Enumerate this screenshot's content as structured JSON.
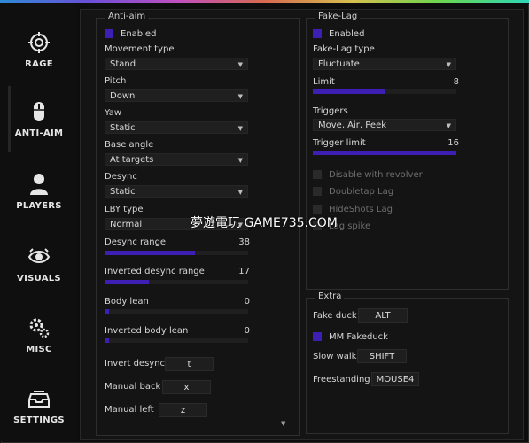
{
  "sidebar": {
    "tabs": [
      {
        "label": "RAGE",
        "icon": "crosshair-icon"
      },
      {
        "label": "ANTI-AIM",
        "icon": "mouse-icon"
      },
      {
        "label": "PLAYERS",
        "icon": "person-icon"
      },
      {
        "label": "VISUALS",
        "icon": "eye-icon"
      },
      {
        "label": "MISC",
        "icon": "gears-icon"
      },
      {
        "label": "SETTINGS",
        "icon": "tray-icon"
      }
    ]
  },
  "antiaim": {
    "title": "Anti-aim",
    "enabled_label": "Enabled",
    "movement_type_label": "Movement type",
    "movement_type_value": "Stand",
    "pitch_label": "Pitch",
    "pitch_value": "Down",
    "yaw_label": "Yaw",
    "yaw_value": "Static",
    "base_angle_label": "Base angle",
    "base_angle_value": "At targets",
    "desync_label": "Desync",
    "desync_value": "Static",
    "lby_type_label": "LBY type",
    "lby_type_value": "Normal",
    "desync_range_label": "Desync range",
    "desync_range_value": "38",
    "desync_range_fraction": 0.63,
    "inv_desync_range_label": "Inverted desync range",
    "inv_desync_range_value": "17",
    "inv_desync_range_fraction": 0.31,
    "body_lean_label": "Body lean",
    "body_lean_value": "0",
    "body_lean_fraction": 0.03,
    "inv_body_lean_label": "Inverted body lean",
    "inv_body_lean_value": "0",
    "inv_body_lean_fraction": 0.03,
    "invert_desync_label": "Invert desync",
    "invert_desync_key": "t",
    "manual_back_label": "Manual back",
    "manual_back_key": "x",
    "manual_left_label": "Manual left",
    "manual_left_key": "z"
  },
  "fakelag": {
    "title": "Fake-Lag",
    "enabled_label": "Enabled",
    "type_label": "Fake-Lag type",
    "type_value": "Fluctuate",
    "limit_label": "Limit",
    "limit_value": "8",
    "limit_fraction": 0.5,
    "triggers_label": "Triggers",
    "triggers_value": "Move, Air, Peek",
    "trigger_limit_label": "Trigger limit",
    "trigger_limit_value": "16",
    "trigger_limit_fraction": 1.0,
    "disable_revolver_label": "Disable with revolver",
    "doubletap_lag_label": "Doubletap Lag",
    "hideshots_lag_label": "HideShots Lag",
    "lag_spike_label": "Lag spike"
  },
  "extra": {
    "title": "Extra",
    "fake_duck_label": "Fake duck",
    "fake_duck_key": "ALT",
    "mm_fakeduck_label": "MM Fakeduck",
    "slow_walk_label": "Slow walk",
    "slow_walk_key": "SHIFT",
    "freestanding_label": "Freestanding",
    "freestanding_key": "MOUSE4"
  },
  "watermark": "夢遊電玩 GAME735.COM",
  "colors": {
    "accent": "#3d1fb3",
    "panel": "#141414",
    "background": "#0e0e0e"
  }
}
